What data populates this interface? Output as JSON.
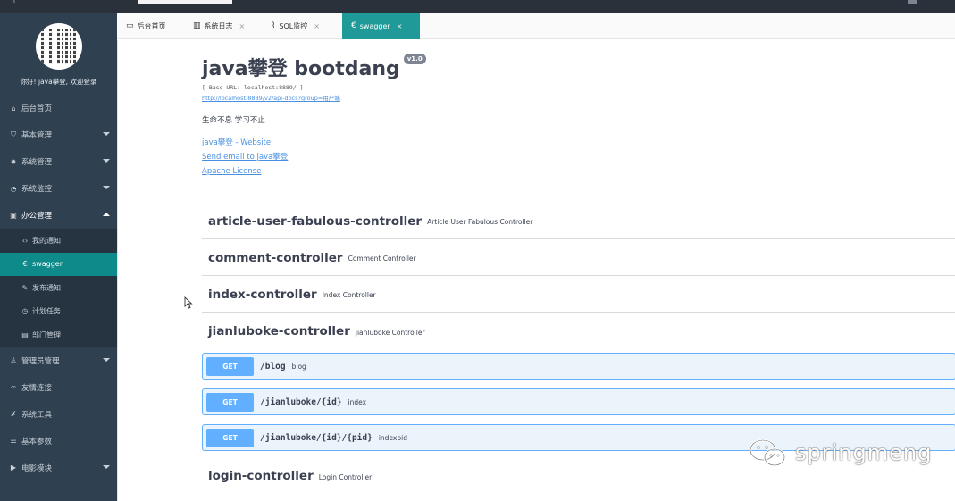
{
  "sidebar": {
    "welcome": "你好! java攀登, 欢迎登录",
    "menu": [
      {
        "label": "后台首页",
        "icon": "home-icon"
      },
      {
        "label": "基本管理",
        "icon": "shield-icon"
      },
      {
        "label": "系统管理",
        "icon": "gear-icon"
      },
      {
        "label": "系统监控",
        "icon": "dashboard-icon"
      },
      {
        "label": "办公管理",
        "icon": "briefcase-icon"
      },
      {
        "label": "管理员管理",
        "icon": "user-icon"
      },
      {
        "label": "友情连接",
        "icon": "link-icon"
      },
      {
        "label": "系统工具",
        "icon": "wrench-icon"
      },
      {
        "label": "基本参数",
        "icon": "list-icon"
      },
      {
        "label": "电影模块",
        "icon": "play-icon"
      }
    ],
    "submenu": [
      {
        "label": "我的通知",
        "icon": "code-icon"
      },
      {
        "label": "swagger",
        "icon": "swagger-icon"
      },
      {
        "label": "发布通知",
        "icon": "edit-icon"
      },
      {
        "label": "计划任务",
        "icon": "clock-icon"
      },
      {
        "label": "部门管理",
        "icon": "calendar-icon"
      }
    ]
  },
  "tabs": [
    {
      "label": "后台首页",
      "icon": "monitor-icon"
    },
    {
      "label": "系统日志",
      "icon": "barcode-icon"
    },
    {
      "label": "SQL监控",
      "icon": "pulse-icon"
    },
    {
      "label": "swagger",
      "icon": "swagger-icon"
    }
  ],
  "info": {
    "title": "java攀登 bootdang",
    "version": "v1.0",
    "base_url": "[ Base URL: localhost:8889/ ]",
    "docs_url": "http://localhost:8889/v2/api-docs?group=用户端",
    "description": "生命不息 学习不止",
    "website_link": "java攀登 - Website",
    "email_link": "Send email to java攀登",
    "license_link": "Apache License"
  },
  "controllers": [
    {
      "name": "article-user-fabulous-controller",
      "desc": "Article User Fabulous Controller"
    },
    {
      "name": "comment-controller",
      "desc": "Comment Controller"
    },
    {
      "name": "index-controller",
      "desc": "Index Controller"
    },
    {
      "name": "jianluboke-controller",
      "desc": "jianluboke Controller"
    }
  ],
  "operations": [
    {
      "method": "GET",
      "path": "/blog",
      "desc": "blog"
    },
    {
      "method": "GET",
      "path": "/jianluboke/{id}",
      "desc": "index"
    },
    {
      "method": "GET",
      "path": "/jianluboke/{id}/{pid}",
      "desc": "indexpid"
    }
  ],
  "controller_last": {
    "name": "login-controller",
    "desc": "Login Controller"
  },
  "watermark": "springmeng",
  "colors": {
    "sidebar": "#2f4050",
    "accent": "#1f9a98",
    "get": "#61affe"
  }
}
